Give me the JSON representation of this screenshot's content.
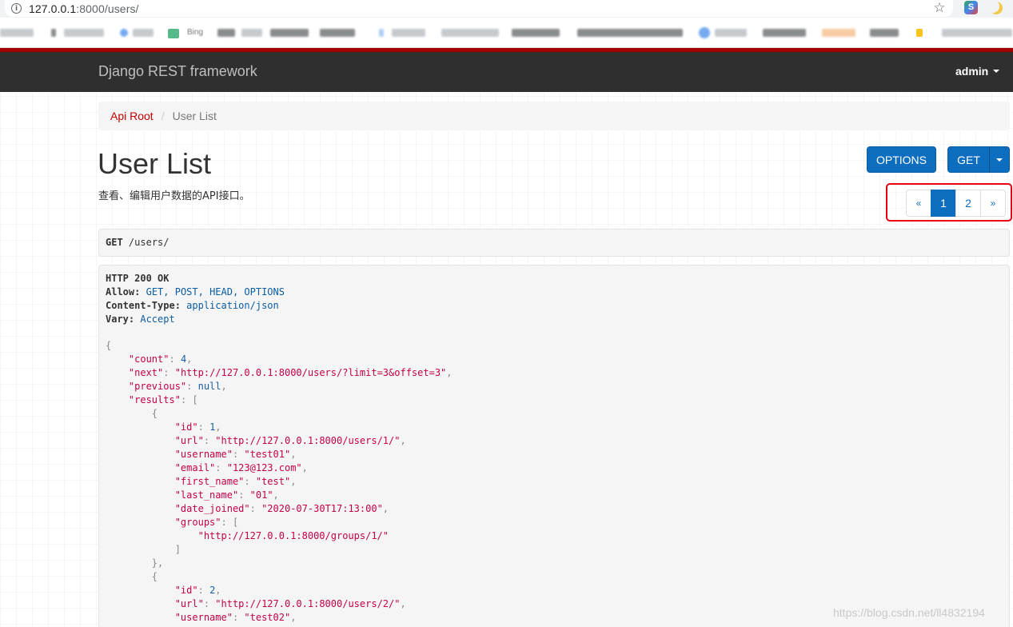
{
  "browser": {
    "url_host": "127.0.0.1",
    "url_rest": ":8000/users/",
    "bookmarks": [
      "Bing"
    ]
  },
  "navbar": {
    "brand": "Django REST framework",
    "user": "admin"
  },
  "breadcrumb": {
    "root": "Api Root",
    "current": "User List"
  },
  "page": {
    "title": "User List",
    "description": "查看、编辑用户数据的API接口。"
  },
  "buttons": {
    "options": "OPTIONS",
    "get": "GET"
  },
  "pagination": {
    "prev": "«",
    "pages": [
      "1",
      "2"
    ],
    "next": "»",
    "active_page": "1"
  },
  "request": {
    "method": "GET",
    "path": "/users/"
  },
  "response": {
    "status": "HTTP 200 OK",
    "headers": [
      {
        "name": "Allow:",
        "value": "GET, POST, HEAD, OPTIONS"
      },
      {
        "name": "Content-Type:",
        "value": "application/json"
      },
      {
        "name": "Vary:",
        "value": "Accept"
      }
    ],
    "json_lines": [
      {
        "indent": "",
        "key": "",
        "value": "",
        "vtype": "",
        "text": "{"
      },
      {
        "indent": "    ",
        "key": "\"count\"",
        "value": "4",
        "vtype": "num",
        "text": ","
      },
      {
        "indent": "    ",
        "key": "\"next\"",
        "value": "\"http://127.0.0.1:8000/users/?limit=3&offset=3\"",
        "vtype": "str",
        "text": ","
      },
      {
        "indent": "    ",
        "key": "\"previous\"",
        "value": "null",
        "vtype": "lit",
        "text": ","
      },
      {
        "indent": "    ",
        "key": "\"results\"",
        "value": "",
        "vtype": "",
        "text": "["
      },
      {
        "indent": "        ",
        "key": "",
        "value": "",
        "vtype": "",
        "text": "{"
      },
      {
        "indent": "            ",
        "key": "\"id\"",
        "value": "1",
        "vtype": "num",
        "text": ","
      },
      {
        "indent": "            ",
        "key": "\"url\"",
        "value": "\"http://127.0.0.1:8000/users/1/\"",
        "vtype": "str",
        "text": ","
      },
      {
        "indent": "            ",
        "key": "\"username\"",
        "value": "\"test01\"",
        "vtype": "str",
        "text": ","
      },
      {
        "indent": "            ",
        "key": "\"email\"",
        "value": "\"123@123.com\"",
        "vtype": "str",
        "text": ","
      },
      {
        "indent": "            ",
        "key": "\"first_name\"",
        "value": "\"test\"",
        "vtype": "str",
        "text": ","
      },
      {
        "indent": "            ",
        "key": "\"last_name\"",
        "value": "\"01\"",
        "vtype": "str",
        "text": ","
      },
      {
        "indent": "            ",
        "key": "\"date_joined\"",
        "value": "\"2020-07-30T17:13:00\"",
        "vtype": "str",
        "text": ","
      },
      {
        "indent": "            ",
        "key": "\"groups\"",
        "value": "",
        "vtype": "",
        "text": "["
      },
      {
        "indent": "                ",
        "key": "",
        "value": "\"http://127.0.0.1:8000/groups/1/\"",
        "vtype": "str",
        "text": ""
      },
      {
        "indent": "            ",
        "key": "",
        "value": "",
        "vtype": "",
        "text": "]"
      },
      {
        "indent": "        ",
        "key": "",
        "value": "",
        "vtype": "",
        "text": "},"
      },
      {
        "indent": "        ",
        "key": "",
        "value": "",
        "vtype": "",
        "text": "{"
      },
      {
        "indent": "            ",
        "key": "\"id\"",
        "value": "2",
        "vtype": "num",
        "text": ","
      },
      {
        "indent": "            ",
        "key": "\"url\"",
        "value": "\"http://127.0.0.1:8000/users/2/\"",
        "vtype": "str",
        "text": ","
      },
      {
        "indent": "            ",
        "key": "\"username\"",
        "value": "\"test02\"",
        "vtype": "str",
        "text": ","
      }
    ]
  },
  "watermark": "https://blog.csdn.net/ll4832194",
  "colors": {
    "brand_red": "#a30000",
    "link_red": "#c20000",
    "button_blue": "#0d6ebf",
    "highlight_red": "#e60012",
    "navbar_bg": "#2f2f2f"
  },
  "icons": [
    "info-icon",
    "star-icon",
    "extension-icon",
    "moon-icon",
    "caret-down-icon"
  ]
}
